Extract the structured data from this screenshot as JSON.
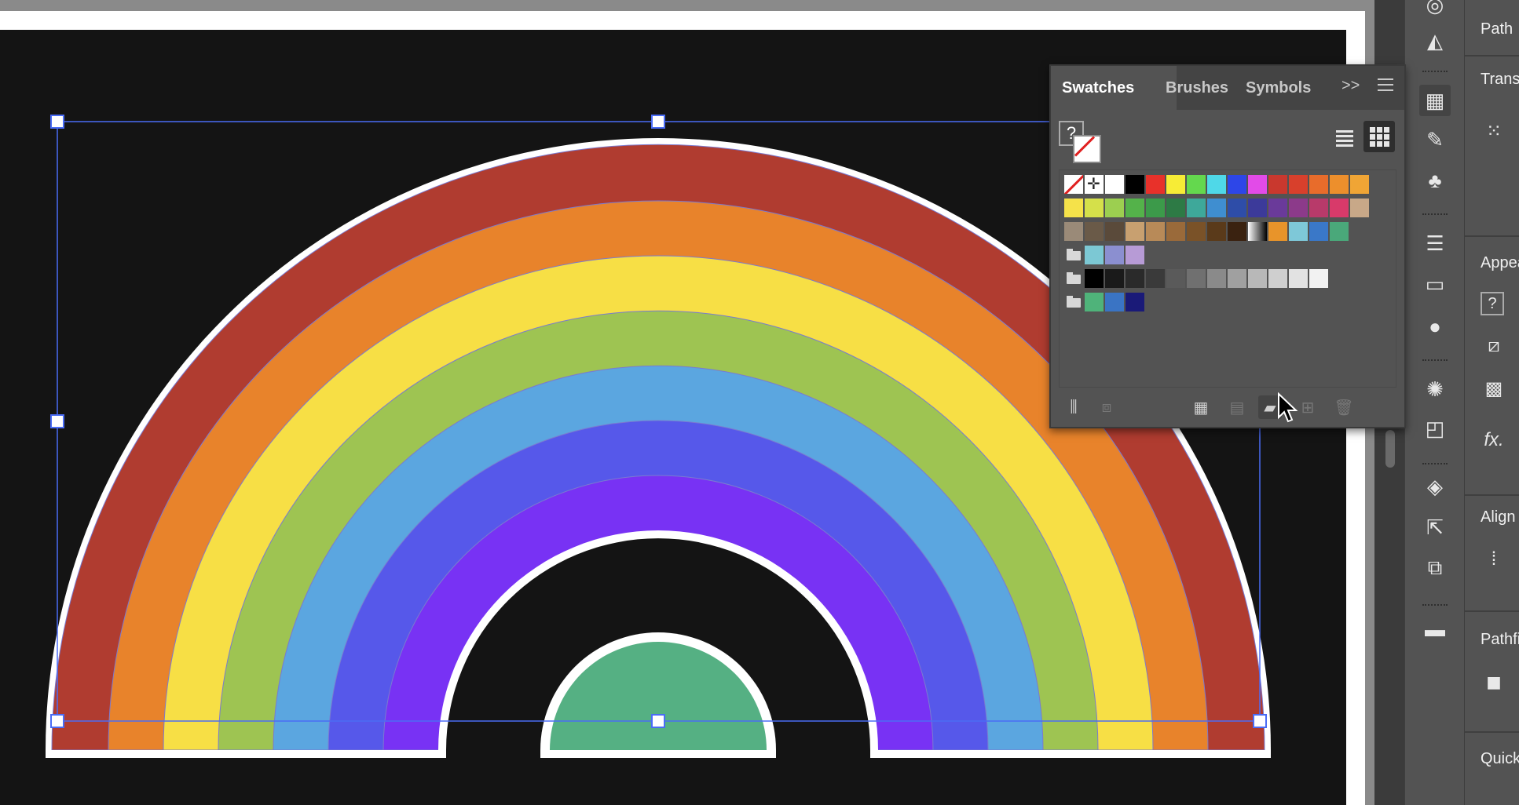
{
  "colors": {
    "workspace": "#8a8a8a",
    "canvas": "#141414",
    "selection": "#4a6cf5",
    "panel": "#535353",
    "accent_red": "#e02020"
  },
  "rainbow": {
    "bands": [
      "#b03c30",
      "#e8832b",
      "#f7df45",
      "#9ec452",
      "#5ba6e0",
      "#5658ea",
      "#7832f4"
    ],
    "inner_fill": "#55b083",
    "outline": "#ffffff"
  },
  "swatches_panel": {
    "tabs": [
      {
        "label": "Swatches",
        "active": true
      },
      {
        "label": "Brushes",
        "active": false
      },
      {
        "label": "Symbols",
        "active": false
      }
    ],
    "overflow_label": ">>",
    "fill_label": "?",
    "rows": [
      [
        "none",
        "registration",
        "#ffffff",
        "#000000",
        "#e8312a",
        "#f7ec36",
        "#64d84e",
        "#4fd8e8",
        "#2d46e8",
        "#e24be8",
        "#c9382e",
        "#d8402c",
        "#e86c2b",
        "#ed8f2c",
        "#f0a535"
      ],
      [
        "#f5e24a",
        "#d5e04a",
        "#9ccf50",
        "#54b24a",
        "#3c9a4a",
        "#2d7a45",
        "#3ea89a",
        "#3f8ed0",
        "#2e4da8",
        "#3c3a9a",
        "#6a3a9a",
        "#8c3a8a",
        "#b83a6a",
        "#d83a6a",
        "#c8a888"
      ],
      [
        "#9a8a78",
        "#6a5a48",
        "#5a4a3a",
        "#c8a070",
        "#b88a58",
        "#9a6a3a",
        "#7a5228",
        "#5a3a1a",
        "#3a2210",
        "gradient",
        "#e8942a",
        "#7ec8d8",
        "#3a78c8",
        "#4aa87a"
      ],
      [
        "folder",
        "#7cc8d4",
        "#8b8fd0",
        "#b79bd6"
      ],
      [
        "folder",
        "#000000",
        "#1a1a1a",
        "#2a2a2a",
        "#3a3a3a",
        "#5a5a5a",
        "#707070",
        "#8a8a8a",
        "#a0a0a0",
        "#b8b8b8",
        "#cfcfcf",
        "#e2e2e2",
        "#f2f2f2"
      ],
      [
        "folder",
        "#4fb37a",
        "#3a74c4",
        "#1a1a78"
      ]
    ]
  },
  "right_panel": {
    "labels": {
      "path": "Path",
      "transform": "Trans",
      "appearance": "Appea",
      "align": "Align",
      "pathfinder": "Pathfi",
      "quick": "Quick"
    },
    "appearance_fill": "?",
    "fx_label": "fx."
  },
  "toolstrip": {
    "icons": [
      "globe-icon",
      "gradient-wedge-icon",
      "swatches-grid-icon",
      "brush-icon",
      "club-symbol-icon",
      "stroke-lines-icon",
      "gradient-icon",
      "transparency-icon",
      "appearance-icon",
      "transform-icon",
      "layers-icon",
      "export-icon",
      "pathfinder-icon",
      "comment-icon"
    ]
  }
}
